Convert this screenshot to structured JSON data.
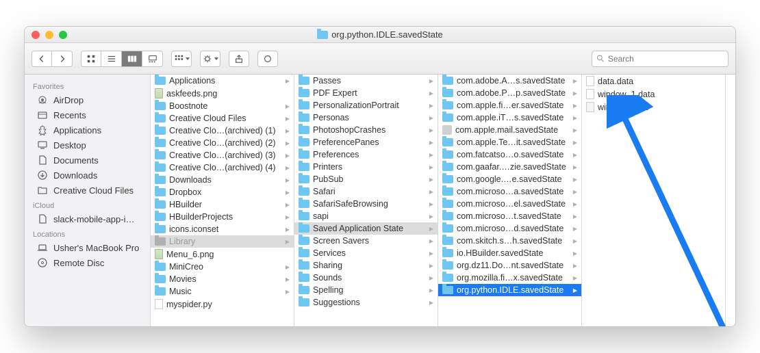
{
  "window_title": "org.python.IDLE.savedState",
  "search": {
    "placeholder": "Search"
  },
  "sidebar": {
    "sections": [
      {
        "label": "Favorites",
        "items": [
          {
            "label": "AirDrop",
            "icon": "airdrop"
          },
          {
            "label": "Recents",
            "icon": "recents"
          },
          {
            "label": "Applications",
            "icon": "applications"
          },
          {
            "label": "Desktop",
            "icon": "desktop"
          },
          {
            "label": "Documents",
            "icon": "documents"
          },
          {
            "label": "Downloads",
            "icon": "downloads"
          },
          {
            "label": "Creative Cloud Files",
            "icon": "folder"
          }
        ]
      },
      {
        "label": "iCloud",
        "items": [
          {
            "label": "slack-mobile-app-i…",
            "icon": "file"
          }
        ]
      },
      {
        "label": "Locations",
        "items": [
          {
            "label": "Usher's MacBook Pro",
            "icon": "laptop"
          },
          {
            "label": "Remote Disc",
            "icon": "disc"
          }
        ]
      }
    ]
  },
  "columns": [
    [
      {
        "label": "Applications",
        "type": "folder",
        "folder": true
      },
      {
        "label": "askfeeds.png",
        "type": "img"
      },
      {
        "label": "Boostnote",
        "type": "folder",
        "folder": true
      },
      {
        "label": "Creative Cloud Files",
        "type": "folder",
        "folder": true
      },
      {
        "label": "Creative Clo…(archived) (1)",
        "type": "folder",
        "folder": true
      },
      {
        "label": "Creative Clo…(archived) (2)",
        "type": "folder",
        "folder": true
      },
      {
        "label": "Creative Clo…(archived) (3)",
        "type": "folder",
        "folder": true
      },
      {
        "label": "Creative Clo…(archived) (4)",
        "type": "folder",
        "folder": true
      },
      {
        "label": "Downloads",
        "type": "folder",
        "folder": true
      },
      {
        "label": "Dropbox",
        "type": "folder",
        "folder": true
      },
      {
        "label": "HBuilder",
        "type": "folder",
        "folder": true
      },
      {
        "label": "HBuilderProjects",
        "type": "folder",
        "folder": true
      },
      {
        "label": "icons.iconset",
        "type": "folder",
        "folder": true
      },
      {
        "label": "Library",
        "type": "grayfolder",
        "folder": true,
        "sel": "muted"
      },
      {
        "label": "Menu_6.png",
        "type": "img"
      },
      {
        "label": "MiniCreo",
        "type": "folder",
        "folder": true
      },
      {
        "label": "Movies",
        "type": "folder",
        "folder": true
      },
      {
        "label": "Music",
        "type": "folder",
        "folder": true
      },
      {
        "label": "myspider.py",
        "type": "file"
      }
    ],
    [
      {
        "label": "Passes",
        "type": "folder",
        "folder": true
      },
      {
        "label": "PDF Expert",
        "type": "folder",
        "folder": true
      },
      {
        "label": "PersonalizationPortrait",
        "type": "folder",
        "folder": true
      },
      {
        "label": "Personas",
        "type": "folder",
        "folder": true
      },
      {
        "label": "PhotoshopCrashes",
        "type": "folder",
        "folder": true
      },
      {
        "label": "PreferencePanes",
        "type": "folder",
        "folder": true
      },
      {
        "label": "Preferences",
        "type": "folder",
        "folder": true
      },
      {
        "label": "Printers",
        "type": "folder",
        "folder": true
      },
      {
        "label": "PubSub",
        "type": "folder",
        "folder": true
      },
      {
        "label": "Safari",
        "type": "folder",
        "folder": true
      },
      {
        "label": "SafariSafeBrowsing",
        "type": "folder",
        "folder": true
      },
      {
        "label": "sapi",
        "type": "folder",
        "folder": true
      },
      {
        "label": "Saved Application State",
        "type": "folder",
        "folder": true,
        "sel": "muted"
      },
      {
        "label": "Screen Savers",
        "type": "folder",
        "folder": true
      },
      {
        "label": "Services",
        "type": "folder",
        "folder": true
      },
      {
        "label": "Sharing",
        "type": "folder",
        "folder": true
      },
      {
        "label": "Sounds",
        "type": "folder",
        "folder": true
      },
      {
        "label": "Spelling",
        "type": "folder",
        "folder": true
      },
      {
        "label": "Suggestions",
        "type": "folder",
        "folder": true
      }
    ],
    [
      {
        "label": "com.adobe.A…s.savedState",
        "type": "folder",
        "folder": true
      },
      {
        "label": "com.adobe.P…p.savedState",
        "type": "folder",
        "folder": true
      },
      {
        "label": "com.apple.fi…er.savedState",
        "type": "folder",
        "folder": true
      },
      {
        "label": "com.apple.iT…s.savedState",
        "type": "folder",
        "folder": true
      },
      {
        "label": "com.apple.mail.savedState",
        "type": "app",
        "folder": true
      },
      {
        "label": "com.apple.Te…it.savedState",
        "type": "folder",
        "folder": true
      },
      {
        "label": "com.fatcatso…o.savedState",
        "type": "folder",
        "folder": true
      },
      {
        "label": "com.gaafar.…zie.savedState",
        "type": "folder",
        "folder": true
      },
      {
        "label": "com.google.…e.savedState",
        "type": "folder",
        "folder": true
      },
      {
        "label": "com.microso…a.savedState",
        "type": "folder",
        "folder": true
      },
      {
        "label": "com.microso…el.savedState",
        "type": "folder",
        "folder": true
      },
      {
        "label": "com.microso…t.savedState",
        "type": "folder",
        "folder": true
      },
      {
        "label": "com.microso…d.savedState",
        "type": "folder",
        "folder": true
      },
      {
        "label": "com.skitch.s…h.savedState",
        "type": "folder",
        "folder": true
      },
      {
        "label": "io.HBuilder.savedState",
        "type": "folder",
        "folder": true
      },
      {
        "label": "org.dz11.Do…nt.savedState",
        "type": "folder",
        "folder": true
      },
      {
        "label": "org.mozilla.fi…x.savedState",
        "type": "folder",
        "folder": true
      },
      {
        "label": "org.python.IDLE.savedState",
        "type": "folder",
        "folder": true,
        "sel": "selected"
      }
    ],
    [
      {
        "label": "data.data",
        "type": "file"
      },
      {
        "label": "window_1.data",
        "type": "file"
      },
      {
        "label": "windows.plist",
        "type": "plist"
      }
    ]
  ]
}
